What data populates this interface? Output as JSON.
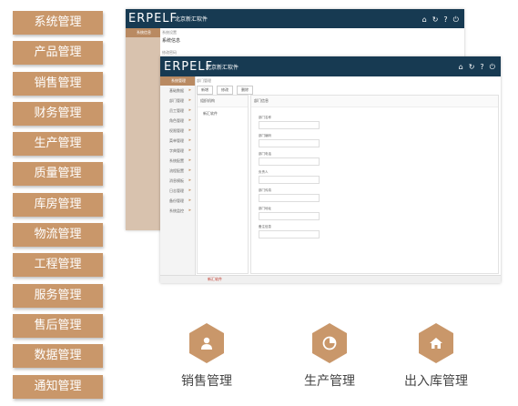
{
  "menu": [
    "系统管理",
    "产品管理",
    "销售管理",
    "财务管理",
    "生产管理",
    "质量管理",
    "库房管理",
    "物流管理",
    "工程管理",
    "服务管理",
    "售后管理",
    "数据管理",
    "通知管理"
  ],
  "screens": {
    "logo": "ERPELF",
    "company": "北京新汇软件",
    "breadcrumb_back": "系统设置",
    "back_section_title": "系统信息",
    "back_sub": "修改密码",
    "front_breadcrumb": "部门管理",
    "front_tabs": [
      "新增",
      "修改",
      "删除"
    ],
    "front_tree_title": "组织机构",
    "front_tree_item": "新汇软件",
    "front_form_title": "部门信息",
    "front_fields": [
      "部门名称",
      "部门编码",
      "部门电话",
      "负责人",
      "部门传真",
      "部门地址",
      "备注信息"
    ],
    "front_sidebar_head": "系统管理",
    "front_sidebar": [
      "基础数据",
      "部门管理",
      "员工管理",
      "角色管理",
      "权限管理",
      "菜单管理",
      "字典管理",
      "系统配置",
      "流程配置",
      "消息模板",
      "日志管理",
      "备份管理",
      "系统监控"
    ],
    "front_status": "新汇软件"
  },
  "features": [
    {
      "label": "销售管理",
      "icon": "person-icon"
    },
    {
      "label": "生产管理",
      "icon": "pie-chart-icon"
    },
    {
      "label": "出入库管理",
      "icon": "home-icon"
    }
  ]
}
